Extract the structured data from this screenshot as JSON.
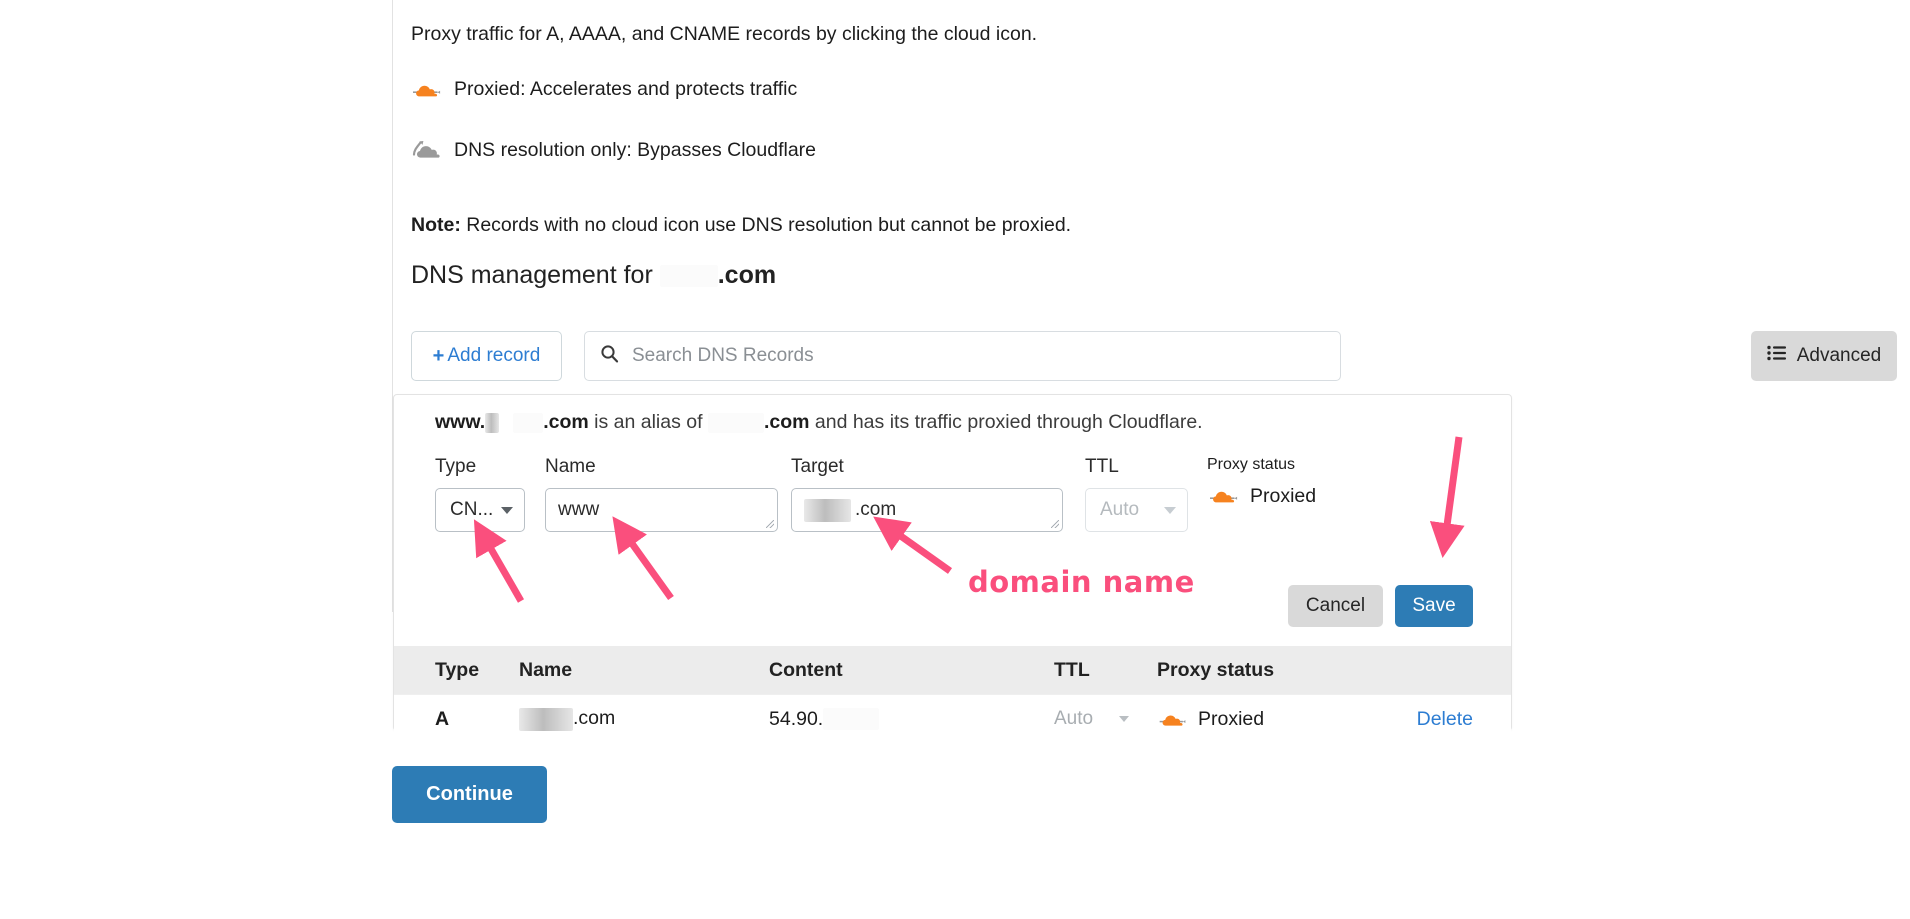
{
  "intro": {
    "proxy_help": "Proxy traffic for A, AAAA, and CNAME records by clicking the cloud icon.",
    "legend_proxied": "Proxied: Accelerates and protects traffic",
    "legend_dns_only": "DNS resolution only: Bypasses Cloudflare",
    "note_prefix": "Note:",
    "note_text": " Records with no cloud icon use DNS resolution but cannot be proxied."
  },
  "heading": {
    "prefix": "DNS management for",
    "domain_suffix": ".com"
  },
  "toolbar": {
    "add_record_plus": "+",
    "add_record_label": "Add record",
    "search_placeholder": "Search DNS Records",
    "search_value": "",
    "search_icon": "search-icon",
    "advanced_label": "Advanced",
    "advanced_icon": "list-settings-icon"
  },
  "card": {
    "alias": {
      "www": "www.",
      "com_1": ".com",
      "middle": " is an alias of ",
      "com_2": ".com",
      "tail": " and has its traffic proxied through Cloudflare."
    },
    "form": {
      "type_label": "Type",
      "type_value": "CN...",
      "name_label": "Name",
      "name_value": "www",
      "target_label": "Target",
      "target_value": ".com",
      "ttl_label": "TTL",
      "ttl_value": "Auto",
      "proxy_label": "Proxy status",
      "proxy_value": "Proxied",
      "proxy_icon": "orange-cloud-proxied-icon"
    },
    "buttons": {
      "cancel": "Cancel",
      "save": "Save"
    },
    "table": {
      "headers": [
        "Type",
        "Name",
        "Content",
        "TTL",
        "Proxy status",
        ""
      ],
      "rows": [
        {
          "type": "A",
          "name_suffix": ".com",
          "content": "54.90.",
          "ttl": "Auto",
          "proxy": "Proxied",
          "action": "Delete"
        }
      ]
    }
  },
  "footer": {
    "continue_label": "Continue"
  },
  "annotations": {
    "domain_name_label": "domain name",
    "arrow_color": "#fa4f7d",
    "arrow_targets": [
      "type-select",
      "name-input",
      "target-input",
      "save-button"
    ]
  },
  "colors": {
    "accent_blue": "#2d7cb5",
    "link_blue": "#2d7dd2",
    "cloudflare_orange": "#f6821f",
    "grey_button": "#d9d9d9",
    "table_header": "#ececec",
    "annotation_pink": "#fa4f7d"
  }
}
